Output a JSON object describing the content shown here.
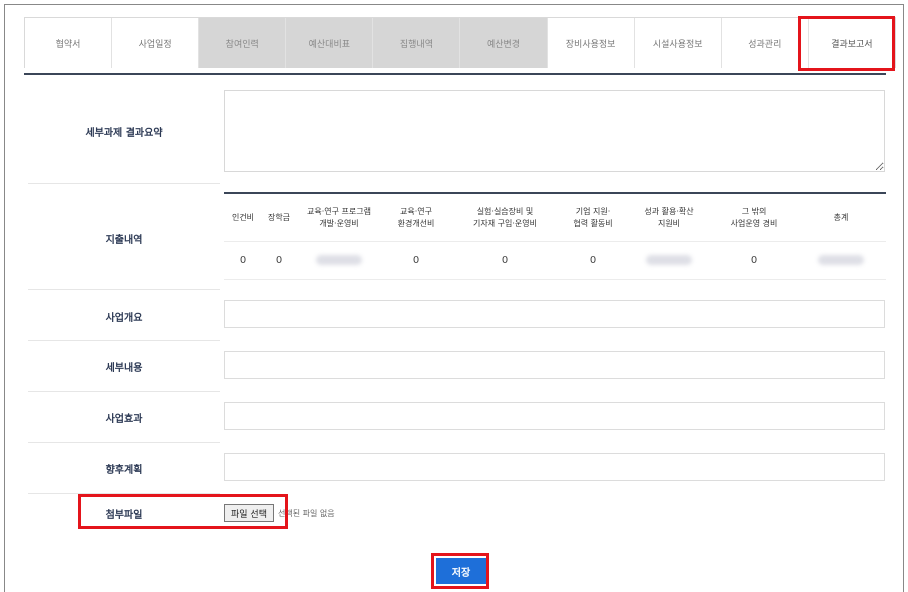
{
  "tabs": [
    {
      "label": "협약서",
      "style": "plain"
    },
    {
      "label": "사업일정",
      "style": "plain"
    },
    {
      "label": "참여인력",
      "style": "grey"
    },
    {
      "label": "예산대비표",
      "style": "grey"
    },
    {
      "label": "집행내역",
      "style": "grey"
    },
    {
      "label": "예산변경",
      "style": "grey"
    },
    {
      "label": "장비사용정보",
      "style": "plain"
    },
    {
      "label": "시설사용정보",
      "style": "plain"
    },
    {
      "label": "성과관리",
      "style": "plain"
    },
    {
      "label": "결과보고서",
      "style": "active"
    }
  ],
  "form": {
    "summary_label": "세부과제 결과요약",
    "expense_label": "지출내역",
    "overview_label": "사업개요",
    "detail_label": "세부내용",
    "effect_label": "사업효과",
    "plan_label": "향후계획",
    "attach_label": "첨부파일"
  },
  "expense": {
    "headers": [
      "인건비",
      "장학금",
      "교육·연구 프로그램\n개발·운영비",
      "교육·연구\n환경개선비",
      "실험·실습장비 및\n기자재 구입·운영비",
      "기업 지원·\n협력 활동비",
      "성과 활용·확산\n지원비",
      "그 밖의\n사업운영 경비",
      "총계"
    ],
    "values": [
      "0",
      "0",
      "",
      "0",
      "0",
      "0",
      "",
      "0",
      ""
    ]
  },
  "file": {
    "button_label": "파일 선택",
    "status_text": "선택된 파일 없음"
  },
  "save_label": "저장",
  "colors": {
    "highlight": "#e4141b",
    "primary_button": "#1e6fd9",
    "header_rule": "#3b4658"
  }
}
